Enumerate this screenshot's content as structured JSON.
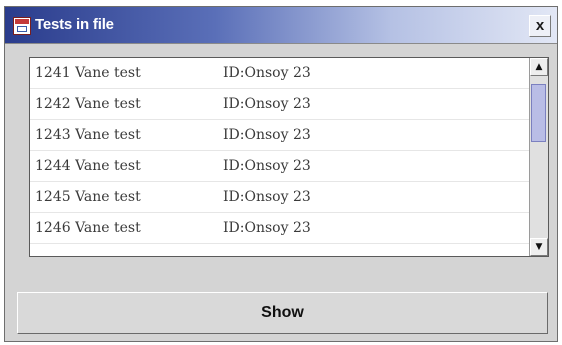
{
  "window": {
    "title": "Tests in file",
    "close_label": "x"
  },
  "list": {
    "rows": [
      {
        "name": "1241 Vane test",
        "id": "ID:Onsoy 23"
      },
      {
        "name": "1242 Vane test",
        "id": "ID:Onsoy 23"
      },
      {
        "name": "1243 Vane test",
        "id": "ID:Onsoy 23"
      },
      {
        "name": "1244 Vane test",
        "id": "ID:Onsoy 23"
      },
      {
        "name": "1245 Vane test",
        "id": "ID:Onsoy 23"
      },
      {
        "name": "1246 Vane test",
        "id": "ID:Onsoy 23"
      }
    ],
    "scroll_up_icon": "arrow-up-icon",
    "scroll_down_icon": "arrow-down-icon"
  },
  "actions": {
    "show_label": "Show"
  },
  "colors": {
    "titlebar_start": "#2a3c8c",
    "titlebar_end": "#e2e7f5",
    "scroll_thumb": "#b9bde6",
    "window_bg": "#d4d4d4"
  }
}
